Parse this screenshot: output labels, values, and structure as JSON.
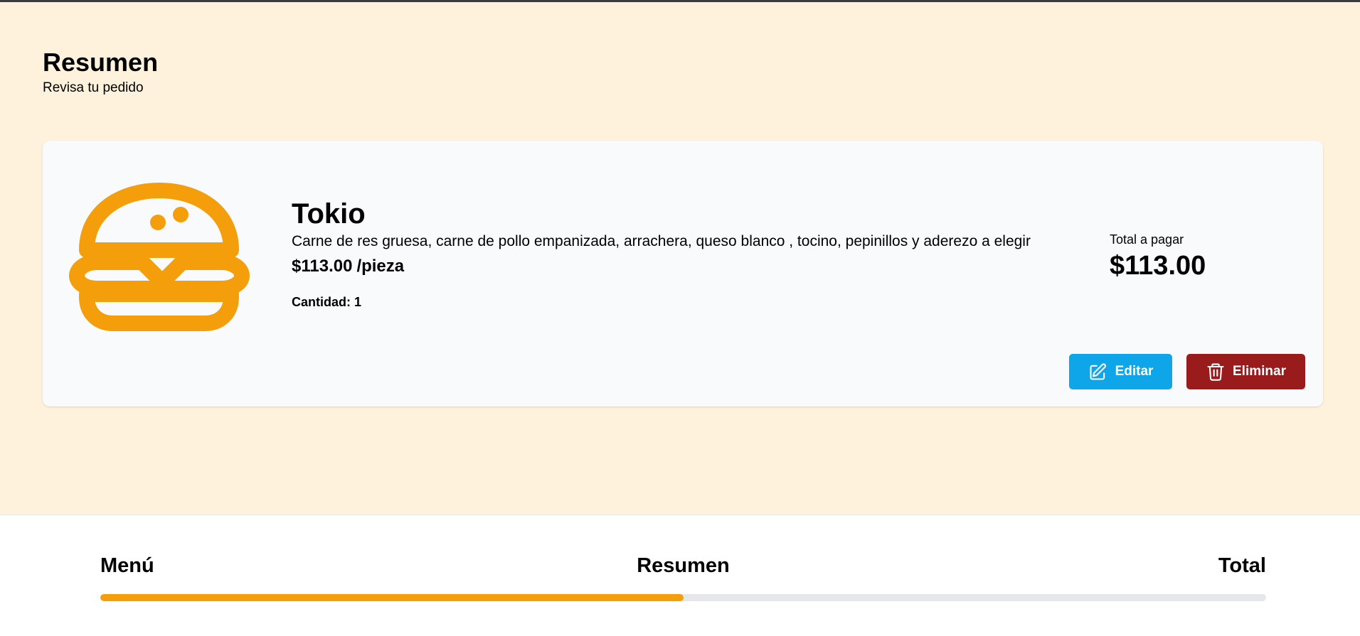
{
  "header": {
    "title": "Resumen",
    "subtitle": "Revisa tu pedido"
  },
  "order_item": {
    "icon": "burger-icon",
    "icon_color": "#f59e0b",
    "name": "Tokio",
    "description": "Carne de res gruesa, carne de pollo empanizada, arrachera, queso blanco , tocino, pepinillos y aderezo a elegir",
    "price": "$113.00",
    "price_unit": "/pieza",
    "quantity_label": "Cantidad:",
    "quantity": "1",
    "total_label": "Total a pagar",
    "total": "$113.00",
    "edit_label": "Editar",
    "edit_icon": "pencil-square-icon",
    "edit_color": "#0ea5e9",
    "delete_label": "Eliminar",
    "delete_icon": "trash-icon",
    "delete_color": "#991b1b"
  },
  "progress": {
    "steps": [
      "Menú",
      "Resumen",
      "Total"
    ],
    "current_step": "Resumen",
    "percent": 50,
    "fill_color": "#f59e0b"
  }
}
